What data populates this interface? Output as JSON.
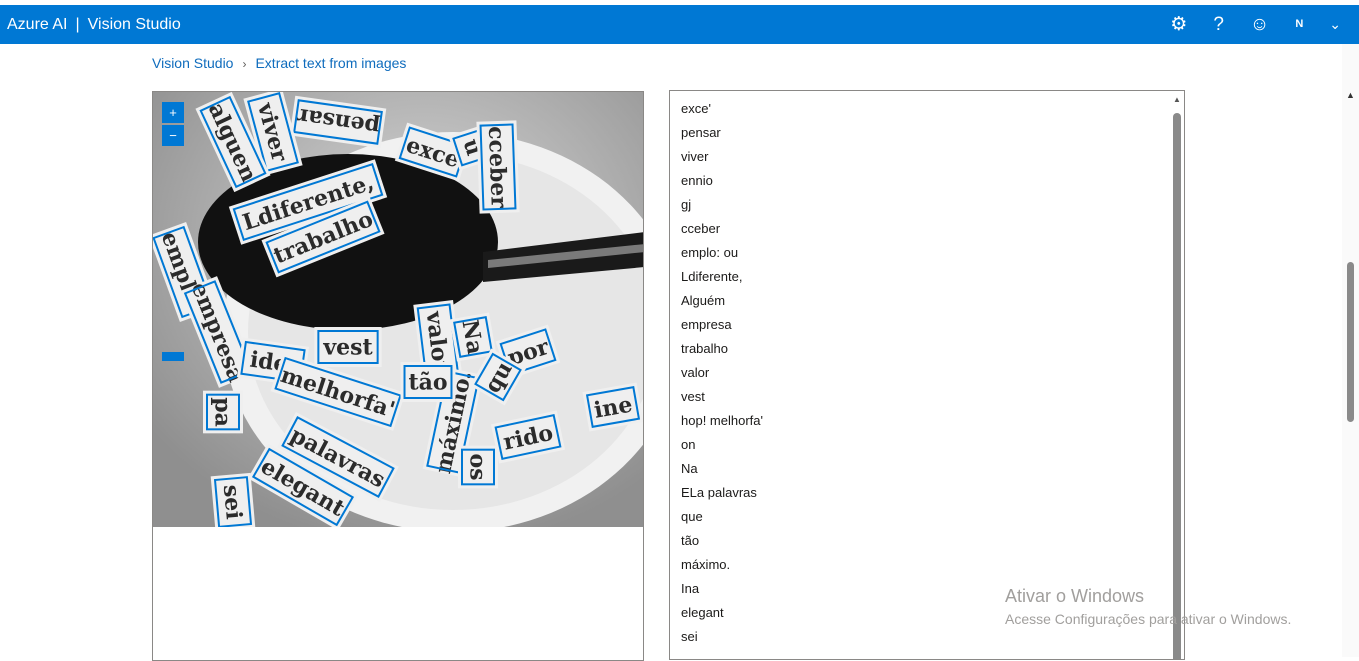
{
  "header": {
    "brand": "Azure AI",
    "separator": "|",
    "product": "Vision Studio",
    "icons": [
      "gear-icon",
      "help-icon",
      "feedback-smiley-icon"
    ],
    "avatar": "N"
  },
  "breadcrumb": {
    "home": "Vision Studio",
    "current": "Extract text from images"
  },
  "image_viewer": {
    "zoom_in": "+",
    "zoom_out": "−",
    "words": [
      "pensar",
      "exce",
      "u",
      "viver",
      "alguen",
      "cceber",
      "Ldiferente,",
      "trabalho",
      "emplo:",
      "empresa",
      "vest",
      "valor",
      "Na",
      "ideı",
      "melhorfa'",
      "máximo.",
      "rido",
      "palavras",
      "elegant",
      "sei",
      "ine",
      "por",
      "qu",
      "tão",
      "os",
      "pa"
    ]
  },
  "results": {
    "lines": [
      "exce'",
      "pensar",
      "viver",
      "ennio",
      "gj",
      "cceber",
      "emplo: ou",
      "Ldiferente,",
      "Alguém",
      "empresa",
      "trabalho",
      "valor",
      "vest",
      "hop! melhorfa'",
      "on",
      "Na",
      "ELa palavras",
      "que",
      "tão",
      "máximo.",
      "Ina",
      "elegant",
      "sei"
    ]
  },
  "watermark": {
    "title": "Ativar o Windows",
    "subtitle": "Acesse Configurações para ativar o Windows."
  },
  "colors": {
    "accent": "#0078d4",
    "link": "#0f6cbd"
  }
}
